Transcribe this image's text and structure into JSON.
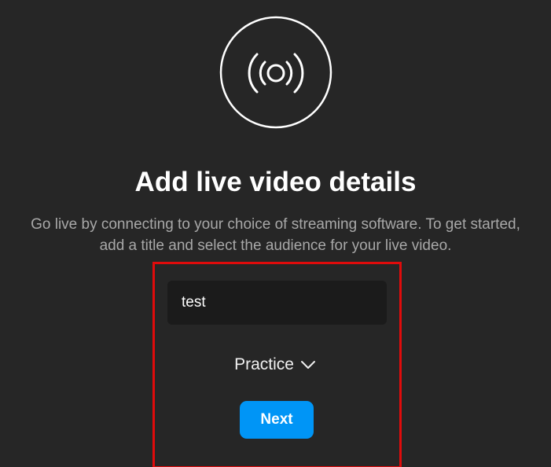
{
  "header": {
    "icon": "live-broadcast-icon",
    "title": "Add live video details",
    "description_line1": "Go live by connecting to your choice of streaming software. To get started,",
    "description_line2": "add a title and select the audience for your live video."
  },
  "form": {
    "title_input_value": "test",
    "audience_selected": "Practice",
    "next_label": "Next"
  },
  "colors": {
    "background": "#262626",
    "input_background": "#1b1b1b",
    "accent": "#0095f6",
    "highlight_border": "#e00b0b",
    "muted_text": "#a8a8a8"
  }
}
